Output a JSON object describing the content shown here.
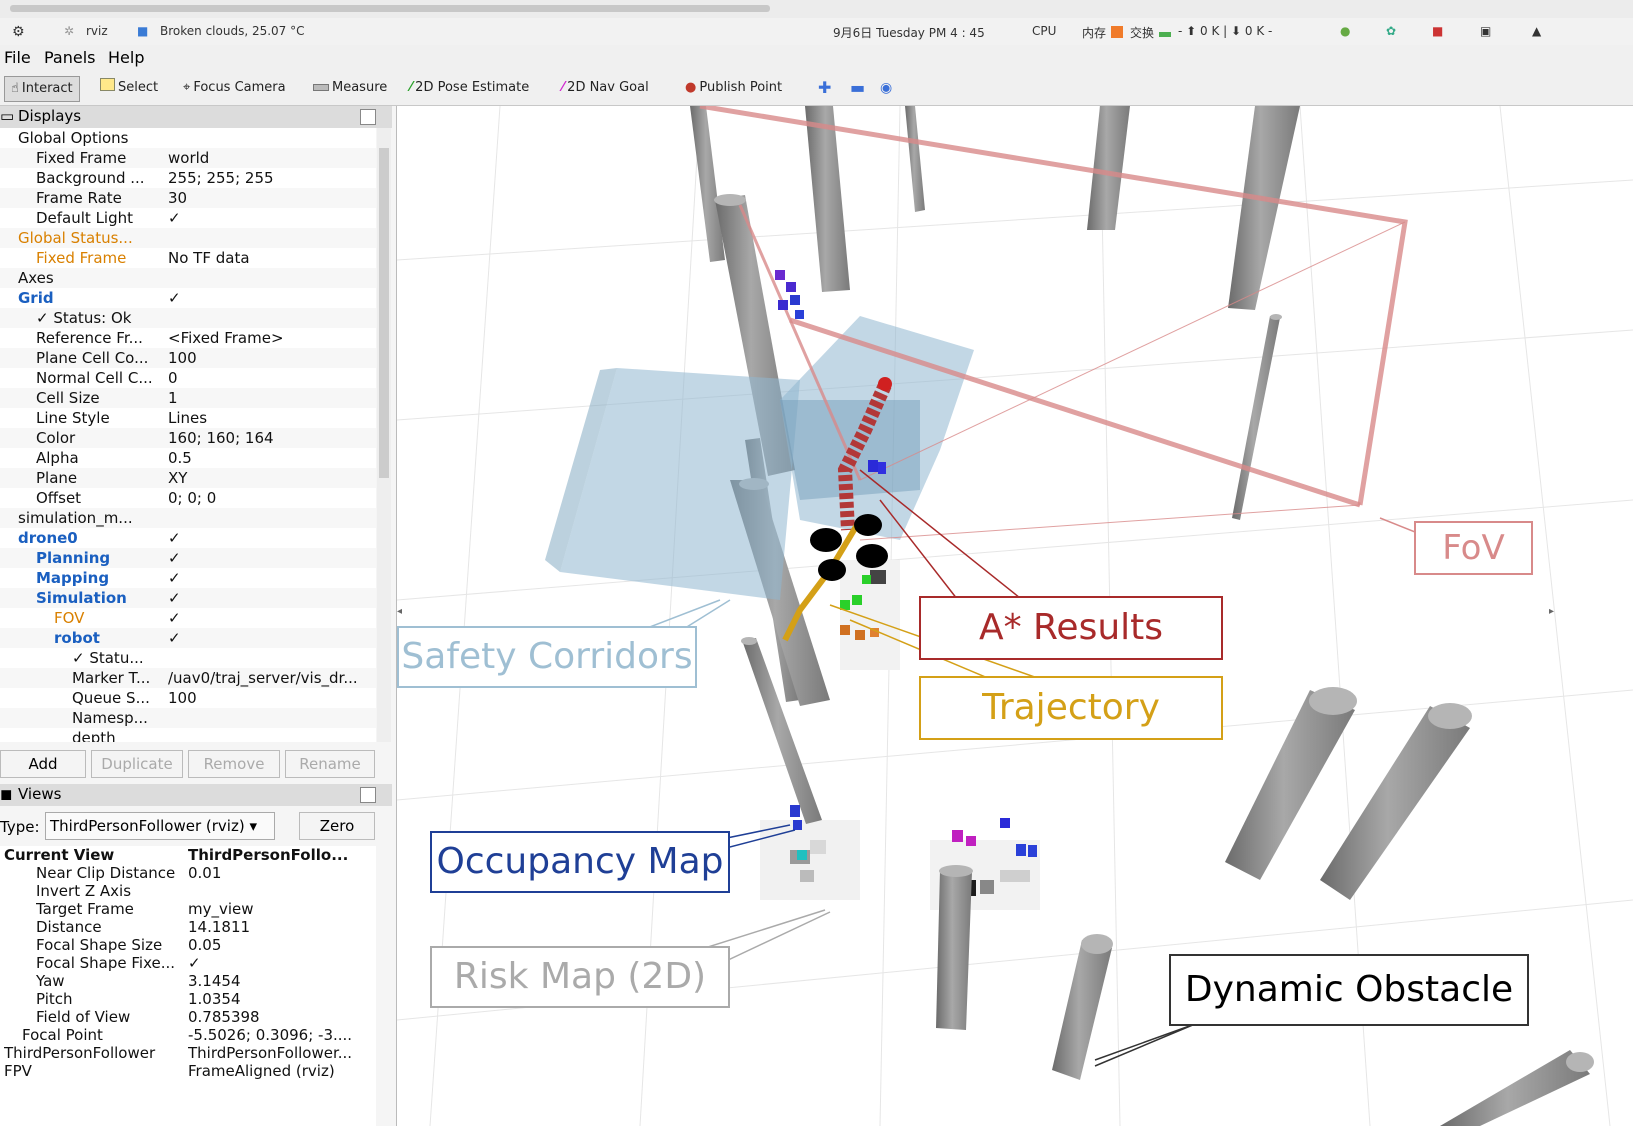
{
  "topbar": {
    "app_name": "rviz",
    "weather": "Broken clouds, 25.07 °C",
    "datetime": "9月6日 Tuesday PM 4 : 45",
    "cpu_label": "CPU",
    "mem_label": "内存",
    "swap_label": "交换",
    "net_stats": "- ⬆  0 K | ⬇  0 K -"
  },
  "menu": {
    "file": "File",
    "panels": "Panels",
    "help": "Help"
  },
  "toolbar": {
    "interact": "Interact",
    "select": "Select",
    "focus_camera": "Focus Camera",
    "measure": "Measure",
    "pose_estimate": "2D Pose Estimate",
    "nav_goal": "2D Nav Goal",
    "publish_point": "Publish Point"
  },
  "displays": {
    "title": "Displays",
    "rows": [
      {
        "key": "Global Options",
        "value": ""
      },
      {
        "key": "Fixed Frame",
        "value": "world"
      },
      {
        "key": "Background ...",
        "value": "255; 255; 255"
      },
      {
        "key": "Frame Rate",
        "value": "30"
      },
      {
        "key": "Default Light",
        "value": "✓"
      },
      {
        "key": "Global Status...",
        "value": ""
      },
      {
        "key": "Fixed Frame",
        "value": "No TF data"
      },
      {
        "key": "Axes",
        "value": ""
      },
      {
        "key": "Grid",
        "value": "✓"
      },
      {
        "key": "✓ Status: Ok",
        "value": ""
      },
      {
        "key": "Reference Fr...",
        "value": "<Fixed Frame>"
      },
      {
        "key": "Plane Cell Co...",
        "value": "100"
      },
      {
        "key": "Normal Cell C...",
        "value": "0"
      },
      {
        "key": "Cell Size",
        "value": "1"
      },
      {
        "key": "Line Style",
        "value": "Lines"
      },
      {
        "key": "Color",
        "value": "160; 160; 164"
      },
      {
        "key": "Alpha",
        "value": "0.5"
      },
      {
        "key": "Plane",
        "value": "XY"
      },
      {
        "key": "Offset",
        "value": "0; 0; 0"
      },
      {
        "key": "simulation_m...",
        "value": ""
      },
      {
        "key": "drone0",
        "value": "✓"
      },
      {
        "key": "Planning",
        "value": "✓"
      },
      {
        "key": "Mapping",
        "value": "✓"
      },
      {
        "key": "Simulation",
        "value": "✓"
      },
      {
        "key": "FOV",
        "value": "✓"
      },
      {
        "key": "robot",
        "value": "✓"
      },
      {
        "key": "✓ Statu...",
        "value": ""
      },
      {
        "key": "Marker T...",
        "value": "/uav0/traj_server/vis_dr..."
      },
      {
        "key": "Queue S...",
        "value": "100"
      },
      {
        "key": "Namesp...",
        "value": ""
      },
      {
        "key": "depth",
        "value": ""
      }
    ],
    "buttons": {
      "add": "Add",
      "duplicate": "Duplicate",
      "remove": "Remove",
      "rename": "Rename"
    }
  },
  "views": {
    "title": "Views",
    "type_label": "Type:",
    "type_value": "ThirdPersonFollower (rviz)",
    "zero": "Zero",
    "rows": [
      {
        "key": "Current View",
        "value": "ThirdPersonFollo..."
      },
      {
        "key": "Near Clip Distance",
        "value": "0.01"
      },
      {
        "key": "Invert Z Axis",
        "value": ""
      },
      {
        "key": "Target Frame",
        "value": "my_view"
      },
      {
        "key": "Distance",
        "value": "14.1811"
      },
      {
        "key": "Focal Shape Size",
        "value": "0.05"
      },
      {
        "key": "Focal Shape Fixe...",
        "value": "✓"
      },
      {
        "key": "Yaw",
        "value": "3.1454"
      },
      {
        "key": "Pitch",
        "value": "1.0354"
      },
      {
        "key": "Field of View",
        "value": "0.785398"
      },
      {
        "key": "Focal Point",
        "value": "-5.5026; 0.3096; -3...."
      },
      {
        "key": "ThirdPersonFollower",
        "value": "ThirdPersonFollower..."
      },
      {
        "key": "FPV",
        "value": "FrameAligned (rviz)"
      }
    ]
  },
  "annotations": {
    "fov": "FoV",
    "astar": "A* Results",
    "trajectory": "Trajectory",
    "safety": "Safety Corridors",
    "occupancy": "Occupancy Map",
    "risk": "Risk Map (2D)",
    "dynamic": "Dynamic Obstacle"
  },
  "colors": {
    "fov": "#d88a8a",
    "astar": "#a82a2a",
    "trajectory": "#d4a017",
    "safety": "#9fbfd3",
    "occupancy": "#1f3f96",
    "risk": "#aaaaaa",
    "dynamic": "#333333"
  }
}
